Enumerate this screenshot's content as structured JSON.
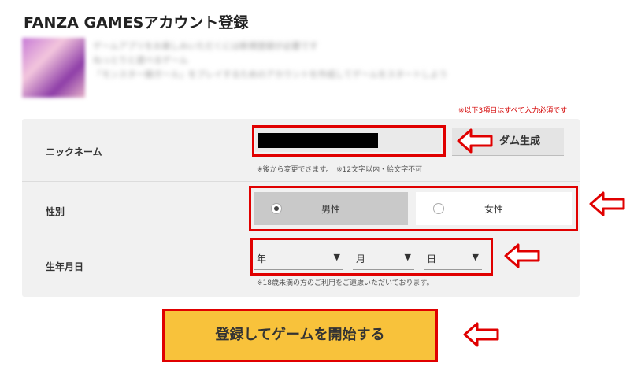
{
  "page": {
    "title": "FANZA GAMESアカウント登録"
  },
  "game": {
    "desc_line1": "ゲームアプリをお楽しみいただくには新規登録が必要です",
    "desc_line2": "ねっとりと遊べるゲーム",
    "desc_line3": "「モンスター娘ガール」をプレイするためのアカウントを作成してゲームをスタートしよう"
  },
  "form": {
    "required_note": "※以下3項目はすべて入力必須です",
    "nickname": {
      "label": "ニックネーム",
      "random_button": "ダム生成",
      "note": "※後から変更できます。　※12文字以内・絵文字不可"
    },
    "gender": {
      "label": "性別",
      "male": "男性",
      "female": "女性",
      "selected": "male"
    },
    "birthday": {
      "label": "生年月日",
      "year": "年",
      "month": "月",
      "day": "日",
      "dropdown_icon": "triangle-down-icon",
      "note": "※18歳未満の方のご利用をご遠慮いただいております。"
    }
  },
  "submit_label": "登録してゲームを開始する",
  "colors": {
    "highlight": "#e00000",
    "submit_bg": "#f8c23b",
    "panel_bg": "#f1f1f1"
  }
}
